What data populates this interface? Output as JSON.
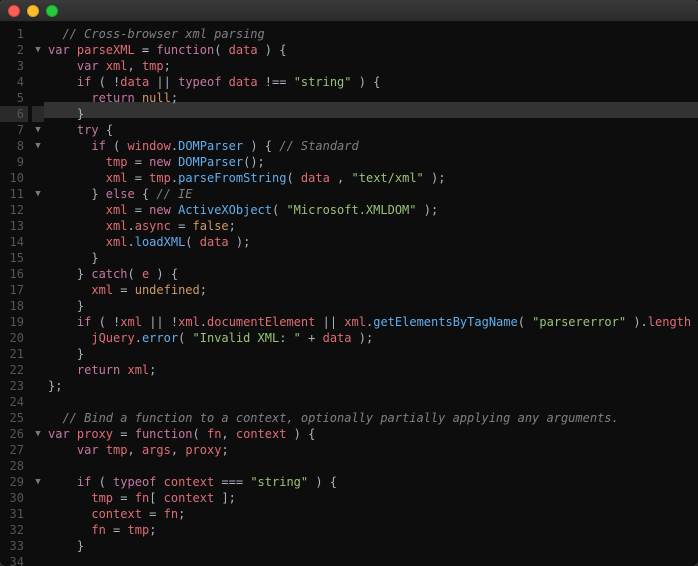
{
  "window": {
    "title": ""
  },
  "editor": {
    "highlighted_line": 6,
    "lines": [
      {
        "n": 1,
        "fold": "",
        "tokens": [
          [
            "  ",
            "d"
          ],
          [
            "// Cross-browser xml parsing",
            "comment"
          ]
        ]
      },
      {
        "n": 2,
        "fold": "▼",
        "tokens": [
          [
            "var ",
            "keyword"
          ],
          [
            "parseXML",
            "ident"
          ],
          [
            " = ",
            "d"
          ],
          [
            "function",
            "keyword"
          ],
          [
            "( ",
            "punct"
          ],
          [
            "data",
            "ident"
          ],
          [
            " ) {",
            "punct"
          ]
        ]
      },
      {
        "n": 3,
        "fold": "",
        "tokens": [
          [
            "    ",
            "d"
          ],
          [
            "var ",
            "keyword"
          ],
          [
            "xml",
            "ident"
          ],
          [
            ", ",
            "punct"
          ],
          [
            "tmp",
            "ident"
          ],
          [
            ";",
            "punct"
          ]
        ]
      },
      {
        "n": 4,
        "fold": "",
        "tokens": [
          [
            "    ",
            "d"
          ],
          [
            "if ",
            "keyword"
          ],
          [
            "( !",
            "punct"
          ],
          [
            "data",
            "ident"
          ],
          [
            " || ",
            "punct"
          ],
          [
            "typeof ",
            "keyword"
          ],
          [
            "data",
            "ident"
          ],
          [
            " !== ",
            "punct"
          ],
          [
            "\"string\"",
            "string"
          ],
          [
            " ) {",
            "punct"
          ]
        ]
      },
      {
        "n": 5,
        "fold": "",
        "tokens": [
          [
            "      ",
            "d"
          ],
          [
            "return ",
            "keyword"
          ],
          [
            "null",
            "number"
          ],
          [
            ";",
            "punct"
          ]
        ]
      },
      {
        "n": 6,
        "fold": "",
        "tokens": [
          [
            "    }",
            "punct"
          ]
        ]
      },
      {
        "n": 7,
        "fold": "▼",
        "tokens": [
          [
            "    ",
            "d"
          ],
          [
            "try ",
            "keyword"
          ],
          [
            "{",
            "punct"
          ]
        ]
      },
      {
        "n": 8,
        "fold": "▼",
        "tokens": [
          [
            "      ",
            "d"
          ],
          [
            "if ",
            "keyword"
          ],
          [
            "( ",
            "punct"
          ],
          [
            "window",
            "ident"
          ],
          [
            ".",
            "punct"
          ],
          [
            "DOMParser",
            "func"
          ],
          [
            " ) { ",
            "punct"
          ],
          [
            "// Standard",
            "comment"
          ]
        ]
      },
      {
        "n": 9,
        "fold": "",
        "tokens": [
          [
            "        ",
            "d"
          ],
          [
            "tmp",
            "ident"
          ],
          [
            " = ",
            "punct"
          ],
          [
            "new ",
            "keyword"
          ],
          [
            "DOMParser",
            "func"
          ],
          [
            "();",
            "punct"
          ]
        ]
      },
      {
        "n": 10,
        "fold": "",
        "tokens": [
          [
            "        ",
            "d"
          ],
          [
            "xml",
            "ident"
          ],
          [
            " = ",
            "punct"
          ],
          [
            "tmp",
            "ident"
          ],
          [
            ".",
            "punct"
          ],
          [
            "parseFromString",
            "func"
          ],
          [
            "( ",
            "punct"
          ],
          [
            "data",
            "ident"
          ],
          [
            " , ",
            "punct"
          ],
          [
            "\"text/xml\"",
            "string"
          ],
          [
            " );",
            "punct"
          ]
        ]
      },
      {
        "n": 11,
        "fold": "▼",
        "tokens": [
          [
            "      } ",
            "punct"
          ],
          [
            "else ",
            "keyword"
          ],
          [
            "{ ",
            "punct"
          ],
          [
            "// IE",
            "comment"
          ]
        ]
      },
      {
        "n": 12,
        "fold": "",
        "tokens": [
          [
            "        ",
            "d"
          ],
          [
            "xml",
            "ident"
          ],
          [
            " = ",
            "punct"
          ],
          [
            "new ",
            "keyword"
          ],
          [
            "ActiveXObject",
            "func"
          ],
          [
            "( ",
            "punct"
          ],
          [
            "\"Microsoft.XMLDOM\"",
            "string"
          ],
          [
            " );",
            "punct"
          ]
        ]
      },
      {
        "n": 13,
        "fold": "",
        "tokens": [
          [
            "        ",
            "d"
          ],
          [
            "xml",
            "ident"
          ],
          [
            ".",
            "punct"
          ],
          [
            "async",
            "ident"
          ],
          [
            " = ",
            "punct"
          ],
          [
            "false",
            "number"
          ],
          [
            ";",
            "punct"
          ]
        ]
      },
      {
        "n": 14,
        "fold": "",
        "tokens": [
          [
            "        ",
            "d"
          ],
          [
            "xml",
            "ident"
          ],
          [
            ".",
            "punct"
          ],
          [
            "loadXML",
            "func"
          ],
          [
            "( ",
            "punct"
          ],
          [
            "data",
            "ident"
          ],
          [
            " );",
            "punct"
          ]
        ]
      },
      {
        "n": 15,
        "fold": "",
        "tokens": [
          [
            "      }",
            "punct"
          ]
        ]
      },
      {
        "n": 16,
        "fold": "",
        "tokens": [
          [
            "    } ",
            "punct"
          ],
          [
            "catch",
            "keyword"
          ],
          [
            "( ",
            "punct"
          ],
          [
            "e",
            "ident"
          ],
          [
            " ) {",
            "punct"
          ]
        ]
      },
      {
        "n": 17,
        "fold": "",
        "tokens": [
          [
            "      ",
            "d"
          ],
          [
            "xml",
            "ident"
          ],
          [
            " = ",
            "punct"
          ],
          [
            "undefined",
            "number"
          ],
          [
            ";",
            "punct"
          ]
        ]
      },
      {
        "n": 18,
        "fold": "",
        "tokens": [
          [
            "    }",
            "punct"
          ]
        ]
      },
      {
        "n": 19,
        "fold": "",
        "tokens": [
          [
            "    ",
            "d"
          ],
          [
            "if ",
            "keyword"
          ],
          [
            "( !",
            "punct"
          ],
          [
            "xml",
            "ident"
          ],
          [
            " || !",
            "punct"
          ],
          [
            "xml",
            "ident"
          ],
          [
            ".",
            "punct"
          ],
          [
            "documentElement",
            "ident"
          ],
          [
            " || ",
            "punct"
          ],
          [
            "xml",
            "ident"
          ],
          [
            ".",
            "punct"
          ],
          [
            "getElementsByTagName",
            "func"
          ],
          [
            "( ",
            "punct"
          ],
          [
            "\"parsererror\"",
            "string"
          ],
          [
            " ).",
            "punct"
          ],
          [
            "length",
            "ident"
          ],
          [
            " ) {",
            "punct"
          ]
        ]
      },
      {
        "n": 20,
        "fold": "",
        "tokens": [
          [
            "      ",
            "d"
          ],
          [
            "jQuery",
            "ident"
          ],
          [
            ".",
            "punct"
          ],
          [
            "error",
            "func"
          ],
          [
            "( ",
            "punct"
          ],
          [
            "\"Invalid XML: \"",
            "string"
          ],
          [
            " + ",
            "punct"
          ],
          [
            "data",
            "ident"
          ],
          [
            " );",
            "punct"
          ]
        ]
      },
      {
        "n": 21,
        "fold": "",
        "tokens": [
          [
            "    }",
            "punct"
          ]
        ]
      },
      {
        "n": 22,
        "fold": "",
        "tokens": [
          [
            "    ",
            "d"
          ],
          [
            "return ",
            "keyword"
          ],
          [
            "xml",
            "ident"
          ],
          [
            ";",
            "punct"
          ]
        ]
      },
      {
        "n": 23,
        "fold": "",
        "tokens": [
          [
            "};",
            "punct"
          ]
        ]
      },
      {
        "n": 24,
        "fold": "",
        "tokens": [
          [
            "",
            "d"
          ]
        ]
      },
      {
        "n": 25,
        "fold": "",
        "tokens": [
          [
            "  ",
            "d"
          ],
          [
            "// Bind a function to a context, optionally partially applying any arguments.",
            "comment"
          ]
        ]
      },
      {
        "n": 26,
        "fold": "▼",
        "tokens": [
          [
            "var ",
            "keyword"
          ],
          [
            "proxy",
            "ident"
          ],
          [
            " = ",
            "punct"
          ],
          [
            "function",
            "keyword"
          ],
          [
            "( ",
            "punct"
          ],
          [
            "fn",
            "ident"
          ],
          [
            ", ",
            "punct"
          ],
          [
            "context",
            "ident"
          ],
          [
            " ) {",
            "punct"
          ]
        ]
      },
      {
        "n": 27,
        "fold": "",
        "tokens": [
          [
            "    ",
            "d"
          ],
          [
            "var ",
            "keyword"
          ],
          [
            "tmp",
            "ident"
          ],
          [
            ", ",
            "punct"
          ],
          [
            "args",
            "ident"
          ],
          [
            ", ",
            "punct"
          ],
          [
            "proxy",
            "ident"
          ],
          [
            ";",
            "punct"
          ]
        ]
      },
      {
        "n": 28,
        "fold": "",
        "tokens": [
          [
            "",
            "d"
          ]
        ]
      },
      {
        "n": 29,
        "fold": "▼",
        "tokens": [
          [
            "    ",
            "d"
          ],
          [
            "if ",
            "keyword"
          ],
          [
            "( ",
            "punct"
          ],
          [
            "typeof ",
            "keyword"
          ],
          [
            "context",
            "ident"
          ],
          [
            " === ",
            "punct"
          ],
          [
            "\"string\"",
            "string"
          ],
          [
            " ) {",
            "punct"
          ]
        ]
      },
      {
        "n": 30,
        "fold": "",
        "tokens": [
          [
            "      ",
            "d"
          ],
          [
            "tmp",
            "ident"
          ],
          [
            " = ",
            "punct"
          ],
          [
            "fn",
            "ident"
          ],
          [
            "[ ",
            "punct"
          ],
          [
            "context",
            "ident"
          ],
          [
            " ];",
            "punct"
          ]
        ]
      },
      {
        "n": 31,
        "fold": "",
        "tokens": [
          [
            "      ",
            "d"
          ],
          [
            "context",
            "ident"
          ],
          [
            " = ",
            "punct"
          ],
          [
            "fn",
            "ident"
          ],
          [
            ";",
            "punct"
          ]
        ]
      },
      {
        "n": 32,
        "fold": "",
        "tokens": [
          [
            "      ",
            "d"
          ],
          [
            "fn",
            "ident"
          ],
          [
            " = ",
            "punct"
          ],
          [
            "tmp",
            "ident"
          ],
          [
            ";",
            "punct"
          ]
        ]
      },
      {
        "n": 33,
        "fold": "",
        "tokens": [
          [
            "    }",
            "punct"
          ]
        ]
      },
      {
        "n": 34,
        "fold": "",
        "tokens": [
          [
            "",
            "d"
          ]
        ]
      }
    ]
  }
}
